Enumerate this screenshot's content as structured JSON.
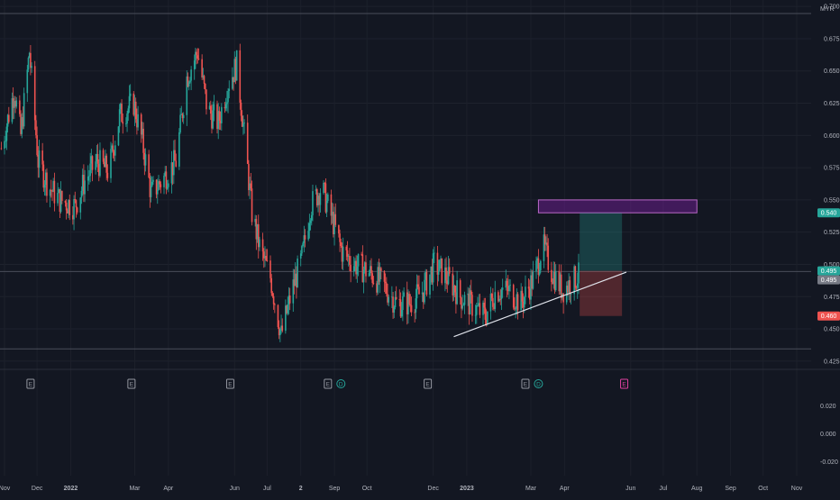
{
  "chart_data": {
    "type": "candlestick",
    "currency_label": "MYR",
    "price_axis": {
      "ylim": [
        0.42,
        0.705
      ],
      "ticks": [
        "0.700",
        "0.675",
        "0.650",
        "0.625",
        "0.600",
        "0.575",
        "0.550",
        "0.525",
        "0.500",
        "0.475",
        "0.450",
        "0.425"
      ],
      "tick_values": [
        0.7,
        0.675,
        0.65,
        0.625,
        0.6,
        0.575,
        0.55,
        0.525,
        0.5,
        0.475,
        0.45,
        0.425
      ]
    },
    "sub_axis": {
      "ylim": [
        -0.03,
        0.045
      ],
      "ticks": [
        "0.020",
        "0.000",
        "-0.020"
      ],
      "tick_values": [
        0.02,
        0.0,
        -0.02
      ]
    },
    "x_axis": {
      "labels": [
        "Nov",
        "Dec",
        "2022",
        "Mar",
        "Apr",
        "Jun",
        "Jul",
        "2",
        "Sep",
        "Oct",
        "Dec",
        "2023",
        "Mar",
        "Apr",
        "Jun",
        "Jul",
        "Aug",
        "Sep",
        "Oct",
        "Nov"
      ],
      "dates": [
        "2021-11-01",
        "2021-12-01",
        "2022-01-01",
        "2022-03-01",
        "2022-04-01",
        "2022-06-01",
        "2022-07-01",
        "2022-08-01",
        "2022-09-01",
        "2022-10-01",
        "2022-12-01",
        "2023-01-01",
        "2023-03-01",
        "2023-04-01",
        "2023-06-01",
        "2023-07-01",
        "2023-08-01",
        "2023-09-01",
        "2023-10-01",
        "2023-11-01"
      ]
    },
    "price_labels": [
      {
        "text": "0.540",
        "value": 0.54,
        "color": "#26a69a"
      },
      {
        "text": "0.495",
        "value": 0.495,
        "color": "#26a69a"
      },
      {
        "text": "0.495",
        "value": 0.495,
        "color": "#787b86"
      },
      {
        "text": "0.460",
        "value": 0.46,
        "color": "#ef5350"
      }
    ],
    "horizontal_lines": [
      0.6945,
      0.4945,
      0.4345
    ],
    "resistance_zone": {
      "x_start": "2023-03-08",
      "x_end": "2023-08-01",
      "y_low": 0.54,
      "y_high": 0.55
    },
    "position": {
      "x_start": "2023-04-15",
      "x_end": "2023-05-24",
      "entry": 0.495,
      "target": 0.54,
      "stop": 0.46
    },
    "trendline": {
      "x1": "2022-12-20",
      "y1": 0.444,
      "x2": "2023-05-28",
      "y2": 0.494
    },
    "events": [
      {
        "date": "2021-11-25",
        "label": "E",
        "type": "earnings"
      },
      {
        "date": "2022-02-26",
        "label": "E",
        "type": "earnings"
      },
      {
        "date": "2022-05-28",
        "label": "E",
        "type": "earnings"
      },
      {
        "date": "2022-08-26",
        "label": "E",
        "type": "earnings"
      },
      {
        "date": "2022-09-07",
        "label": "D",
        "type": "dividend"
      },
      {
        "date": "2022-11-26",
        "label": "E",
        "type": "earnings"
      },
      {
        "date": "2023-02-24",
        "label": "E",
        "type": "earnings"
      },
      {
        "date": "2023-03-08",
        "label": "D",
        "type": "dividend"
      },
      {
        "date": "2023-05-26",
        "label": "E",
        "type": "upcoming"
      }
    ],
    "price_path": [
      [
        "2021-10-29",
        0.59
      ],
      [
        "2021-11-10",
        0.635
      ],
      [
        "2021-11-16",
        0.6
      ],
      [
        "2021-11-24",
        0.665
      ],
      [
        "2021-12-02",
        0.58
      ],
      [
        "2021-12-12",
        0.56
      ],
      [
        "2021-12-22",
        0.55
      ],
      [
        "2022-01-05",
        0.545
      ],
      [
        "2022-01-14",
        0.565
      ],
      [
        "2022-01-25",
        0.58
      ],
      [
        "2022-02-05",
        0.572
      ],
      [
        "2022-02-15",
        0.615
      ],
      [
        "2022-02-28",
        0.625
      ],
      [
        "2022-03-08",
        0.595
      ],
      [
        "2022-03-16",
        0.555
      ],
      [
        "2022-03-26",
        0.565
      ],
      [
        "2022-04-08",
        0.58
      ],
      [
        "2022-04-18",
        0.645
      ],
      [
        "2022-04-28",
        0.665
      ],
      [
        "2022-05-07",
        0.62
      ],
      [
        "2022-05-17",
        0.61
      ],
      [
        "2022-05-26",
        0.64
      ],
      [
        "2022-06-03",
        0.655
      ],
      [
        "2022-06-10",
        0.6
      ],
      [
        "2022-06-17",
        0.54
      ],
      [
        "2022-06-25",
        0.51
      ],
      [
        "2022-07-04",
        0.49
      ],
      [
        "2022-07-14",
        0.445
      ],
      [
        "2022-07-24",
        0.48
      ],
      [
        "2022-08-02",
        0.505
      ],
      [
        "2022-08-10",
        0.545
      ],
      [
        "2022-08-20",
        0.56
      ],
      [
        "2022-08-30",
        0.535
      ],
      [
        "2022-09-08",
        0.51
      ],
      [
        "2022-09-20",
        0.5
      ],
      [
        "2022-10-01",
        0.495
      ],
      [
        "2022-10-15",
        0.485
      ],
      [
        "2022-10-28",
        0.47
      ],
      [
        "2022-11-10",
        0.47
      ],
      [
        "2022-11-22",
        0.48
      ],
      [
        "2022-12-02",
        0.5
      ],
      [
        "2022-12-14",
        0.49
      ],
      [
        "2022-12-26",
        0.475
      ],
      [
        "2023-01-06",
        0.468
      ],
      [
        "2023-01-18",
        0.46
      ],
      [
        "2023-01-28",
        0.48
      ],
      [
        "2023-02-08",
        0.48
      ],
      [
        "2023-02-20",
        0.47
      ],
      [
        "2023-03-04",
        0.49
      ],
      [
        "2023-03-12",
        0.515
      ],
      [
        "2023-03-20",
        0.495
      ],
      [
        "2023-03-30",
        0.48
      ],
      [
        "2023-04-08",
        0.487
      ],
      [
        "2023-04-16",
        0.492
      ]
    ]
  }
}
